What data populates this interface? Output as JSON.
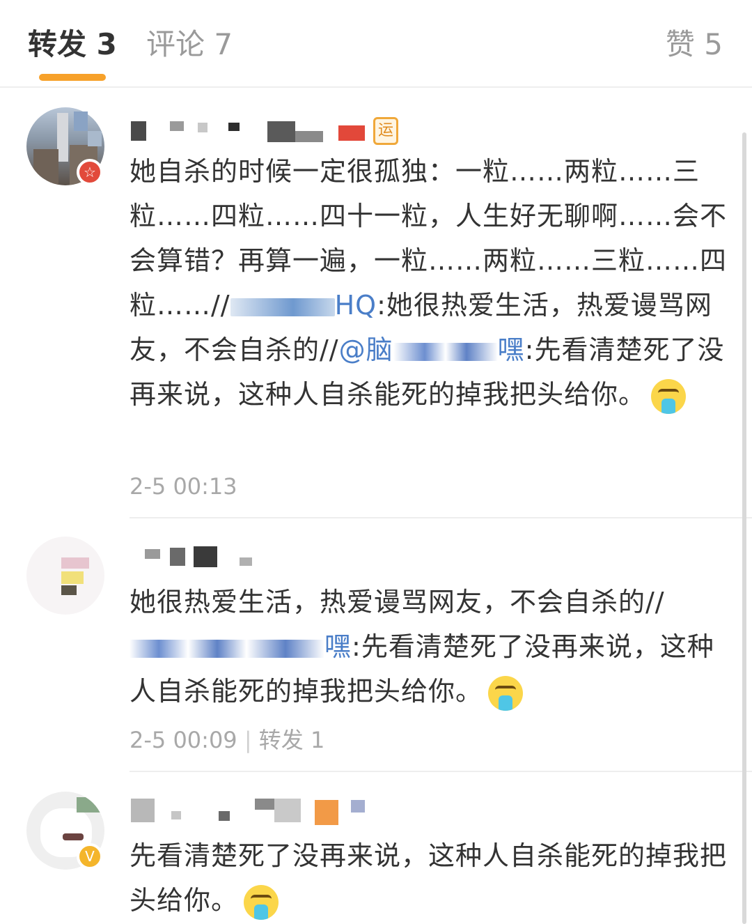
{
  "tabs": {
    "repost": "转发 3",
    "comment": "评论 7",
    "like": "赞 5"
  },
  "posts": [
    {
      "text_parts": {
        "a": "她自杀的时候一定很孤独：一粒……两粒……三粒……四粒……四十一粒，人生好无聊啊……会不会算错？再算一遍，一粒……两粒……三粒……四粒……//",
        "m1": "HQ",
        "b": ":她很热爱生活，热爱谩骂网友，不会自杀的//",
        "m2a": "@脑",
        "m2b": "嘿",
        "c": ":先看清楚死了没再来说，这种人自杀能死的掉我把头给你。"
      },
      "time": "2-5 00:13"
    },
    {
      "text_parts": {
        "a": "她很热爱生活，热爱谩骂网友，不会自杀的//",
        "m1": "嘿",
        "b": ":先看清楚死了没再来说，这种人自杀能死的掉我把头给你。"
      },
      "time": "2-5 00:09",
      "separator": "|",
      "repost": "转发 1"
    },
    {
      "text": "先看清楚死了没再来说，这种人自杀能死的掉我把头给你。"
    }
  ],
  "icons": {
    "level_badge": "运",
    "badge_red": "☆",
    "badge_gold": "V"
  },
  "colors": {
    "accent": "#f7a12a",
    "mention": "#4a7ec8",
    "muted": "#a8a8a8"
  }
}
